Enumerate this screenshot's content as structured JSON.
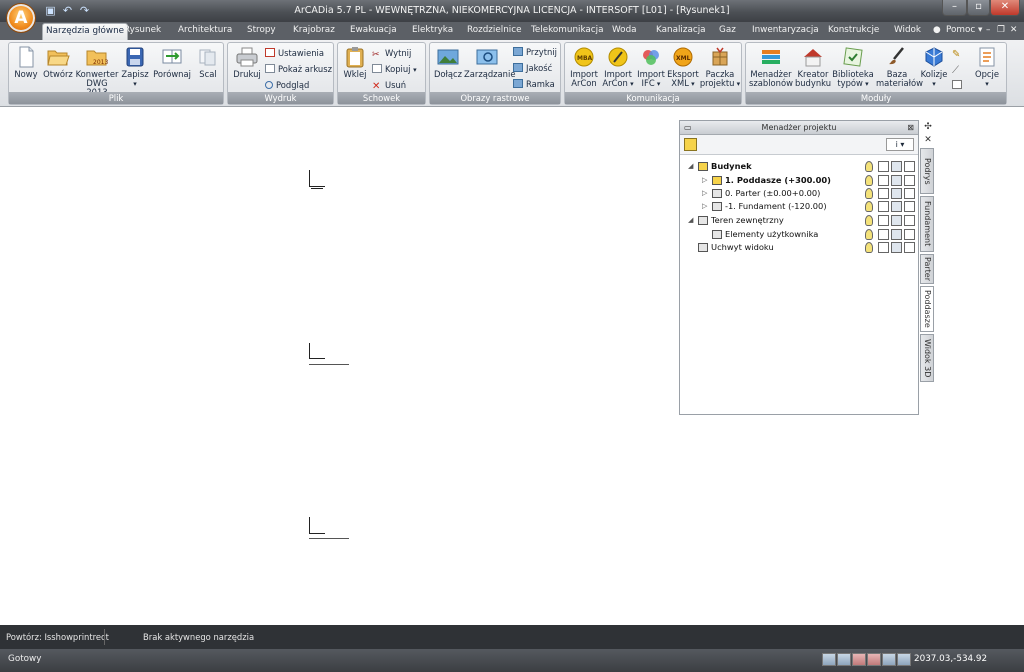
{
  "window": {
    "title": "ArCADia 5.7 PL - WEWNĘTRZNA, NIEKOMERCYJNA LICENCJA - INTERSOFT [L01] - [Rysunek1]",
    "app_logo": "A"
  },
  "tabs": [
    "Narzędzia główne",
    "Rysunek",
    "Architektura",
    "Stropy",
    "Krajobraz",
    "Ewakuacja",
    "Elektryka",
    "Rozdzielnice",
    "Telekomunikacja",
    "Woda",
    "Kanalizacja",
    "Gaz",
    "Inwentaryzacja",
    "Konstrukcje",
    "Widok"
  ],
  "help_label": "Pomoc",
  "ribbon": {
    "plik": {
      "label": "Plik",
      "nowy": "Nowy",
      "otworz": "Otwórz",
      "konwerter1": "Konwerter",
      "konwerter2": "DWG 2013",
      "konwerter_badge": "2013",
      "zapisz": "Zapisz",
      "porownaj": "Porównaj",
      "scal": "Scal"
    },
    "wydruk": {
      "label": "Wydruk",
      "drukuj": "Drukuj",
      "ustawienia": "Ustawienia",
      "pokaz_arkusz": "Pokaż arkusz",
      "podglad": "Podgląd"
    },
    "schowek": {
      "label": "Schowek",
      "wklej": "Wklej",
      "wytnij": "Wytnij",
      "kopiuj": "Kopiuj",
      "usun": "Usuń"
    },
    "obrazy": {
      "label": "Obrazy rastrowe",
      "dolacz": "Dołącz",
      "zarzadzanie": "Zarządzanie",
      "przytnij": "Przytnij",
      "jakosc": "Jakość",
      "ramka": "Ramka"
    },
    "komunikacja": {
      "label": "Komunikacja",
      "import_arcon1": "Import",
      "import_arcon2": "ArCon",
      "import_arcon_b1": "Import",
      "import_arcon_b2": "ArCon",
      "import_ifc1": "Import",
      "import_ifc2": "IFC",
      "eksport1": "Eksport",
      "eksport2": "XML",
      "paczka1": "Paczka",
      "paczka2": "projektu",
      "badge_mba": "MBA",
      "badge_xml": "XML"
    },
    "moduly": {
      "label": "Moduły",
      "menadzer1": "Menadżer",
      "menadzer2": "szablonów",
      "kreator1": "Kreator",
      "kreator2": "budynku",
      "biblioteka1": "Biblioteka",
      "biblioteka2": "typów",
      "baza1": "Baza",
      "baza2": "materiałów",
      "kolizje": "Kolizje",
      "opcje": "Opcje"
    }
  },
  "project_manager": {
    "title": "Menadżer projektu",
    "toolbar_right": "i",
    "tree": [
      {
        "label": "Budynek",
        "bold": true,
        "level": 0
      },
      {
        "label": "1. Poddasze (+300.00)",
        "bold": true,
        "level": 1
      },
      {
        "label": "0. Parter (±0.00+0.00)",
        "bold": false,
        "level": 1
      },
      {
        "label": "-1. Fundament (-120.00)",
        "bold": false,
        "level": 1
      },
      {
        "label": "Teren zewnętrzny",
        "bold": false,
        "level": 0
      },
      {
        "label": "Elementy użytkownika",
        "bold": false,
        "level": 1
      },
      {
        "label": "Uchwyt widoku",
        "bold": false,
        "level": 0
      }
    ],
    "side_tabs": [
      "Podrys",
      "Fundament",
      "Parter",
      "Poddasze",
      "Widok 3D"
    ]
  },
  "command_bar": {
    "repeat": "Powtórz: Isshowprintrect",
    "status": "Brak aktywnego narzędzia"
  },
  "status_bar": {
    "ready": "Gotowy",
    "coordinates": "2037.03,-534.92"
  }
}
